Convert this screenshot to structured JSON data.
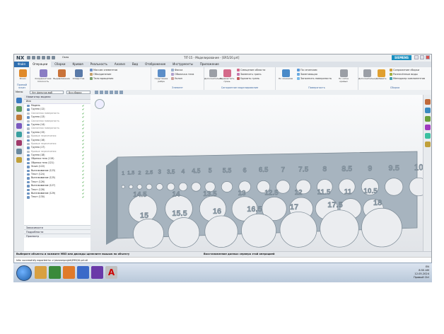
{
  "titlebar": {
    "app": "NX",
    "title": "TIT-15 - Моделирование - [ER5/20.prt]",
    "qa_label": "Окно",
    "brand": "SIEMENS"
  },
  "menu": [
    "Файл",
    "Операции",
    "Сборки",
    "Кривая",
    "Реальность",
    "Анализ",
    "Вид",
    "Отображение",
    "Инструменты",
    "Приложение"
  ],
  "ribbon": {
    "groups": [
      {
        "label": "Прямой эскиз",
        "buttons": [
          "Эскиз"
        ],
        "small": []
      },
      {
        "label": "",
        "buttons": [
          "Координатная плоскость",
          "Выдавливание",
          "Отверстие"
        ],
        "small": [
          "Массив элементов",
          "Объединение",
          "Тело вращения"
        ]
      },
      {
        "label": "Элемент",
        "buttons": [
          "Скругление ребра",
          "Фаска"
        ],
        "small": [
          "Оболочка тела",
          "Уклон"
        ]
      },
      {
        "label": "Синхронное моделирование",
        "buttons": [
          "Дополнительно",
          "Переместить грань"
        ],
        "small": [
          "Смещение области",
          "Заменить грань",
          "Удалить грань"
        ]
      },
      {
        "label": "Поверхность",
        "buttons": [
          "По сечениям",
          "По сетке кривых"
        ],
        "small": [
          "По сечениям",
          "Заметающая",
          "Заполнить поверхность"
        ]
      },
      {
        "label": "Сборка",
        "buttons": [
          "Дополнительно",
          "Добавить"
        ],
        "small": [
          "Сопряжение сборки",
          "Разнесённые виды",
          "Менеджер компонентов"
        ]
      }
    ]
  },
  "toolbar2": {
    "menu": "Меню",
    "filter": "Нет фильтра выб",
    "scope": "Вся сборка"
  },
  "navigator": {
    "title": "Навигатор модели",
    "col_name": "Имя",
    "rows": [
      {
        "label": "Модель",
        "grey": false
      },
      {
        "label": "Группа (12)",
        "grey": false
      },
      {
        "label": "Связанная поверхность",
        "grey": true
      },
      {
        "label": "Группа (13)",
        "grey": false
      },
      {
        "label": "Связанная поверхность",
        "grey": true
      },
      {
        "label": "Группа (14)",
        "grey": false
      },
      {
        "label": "Связанная поверхность",
        "grey": true
      },
      {
        "label": "Группа (15)",
        "grey": false
      },
      {
        "label": "Кривые пересечения",
        "grey": true
      },
      {
        "label": "Группа (16)",
        "grey": false
      },
      {
        "label": "Кривые пересечения",
        "grey": true
      },
      {
        "label": "Группа (17)",
        "grey": false
      },
      {
        "label": "Кривые пересечения",
        "grey": true
      },
      {
        "label": "Группа (18)",
        "grey": false
      },
      {
        "label": "Обрезка тела (119)",
        "grey": false
      },
      {
        "label": "Обрезка тела (121)",
        "grey": false
      },
      {
        "label": "Эскиз (122)",
        "grey": false
      },
      {
        "label": "Выталкивание (123)",
        "grey": false
      },
      {
        "label": "Текст (124)",
        "grey": false
      },
      {
        "label": "Выталкивание (125)",
        "grey": false
      },
      {
        "label": "Текст (126)",
        "grey": false
      },
      {
        "label": "Выталкивание (127)",
        "grey": false
      },
      {
        "label": "Текст (128)",
        "grey": false
      },
      {
        "label": "Выталкивание (129)",
        "grey": false
      },
      {
        "label": "Текст (130)",
        "grey": false
      }
    ],
    "sections": [
      "Зависимости",
      "Подробности",
      "Просмотр"
    ]
  },
  "plate": {
    "row1_labels": [
      "1",
      "1.5",
      "2",
      "2.5",
      "3",
      "3.5",
      "4",
      "4.5",
      "5",
      "5.5",
      "6",
      "6.5",
      "7",
      "7.5",
      "8",
      "8.5",
      "9",
      "9.5",
      "10"
    ],
    "row2_labels": [
      "14.5",
      "14",
      "13.5",
      "13",
      "12.5",
      "12",
      "11.5",
      "11",
      "10.5"
    ],
    "row3_labels": [
      "15",
      "15.5",
      "16",
      "16.5",
      "17",
      "17.5",
      "18"
    ]
  },
  "status": {
    "left": "Выберите объекты и нажмите MB3 или дважды щелкните мышью по объекту",
    "right": "Восстановление данных сервера этой операцией"
  },
  "output": "Info: successfully exported to: c:\\rezonerprojek\\ER5\\20.prt.stl",
  "tray": {
    "lang": "EN",
    "time": "8:50 AM",
    "date": "12.05.2024",
    "extra": "Правый Ctrl"
  }
}
